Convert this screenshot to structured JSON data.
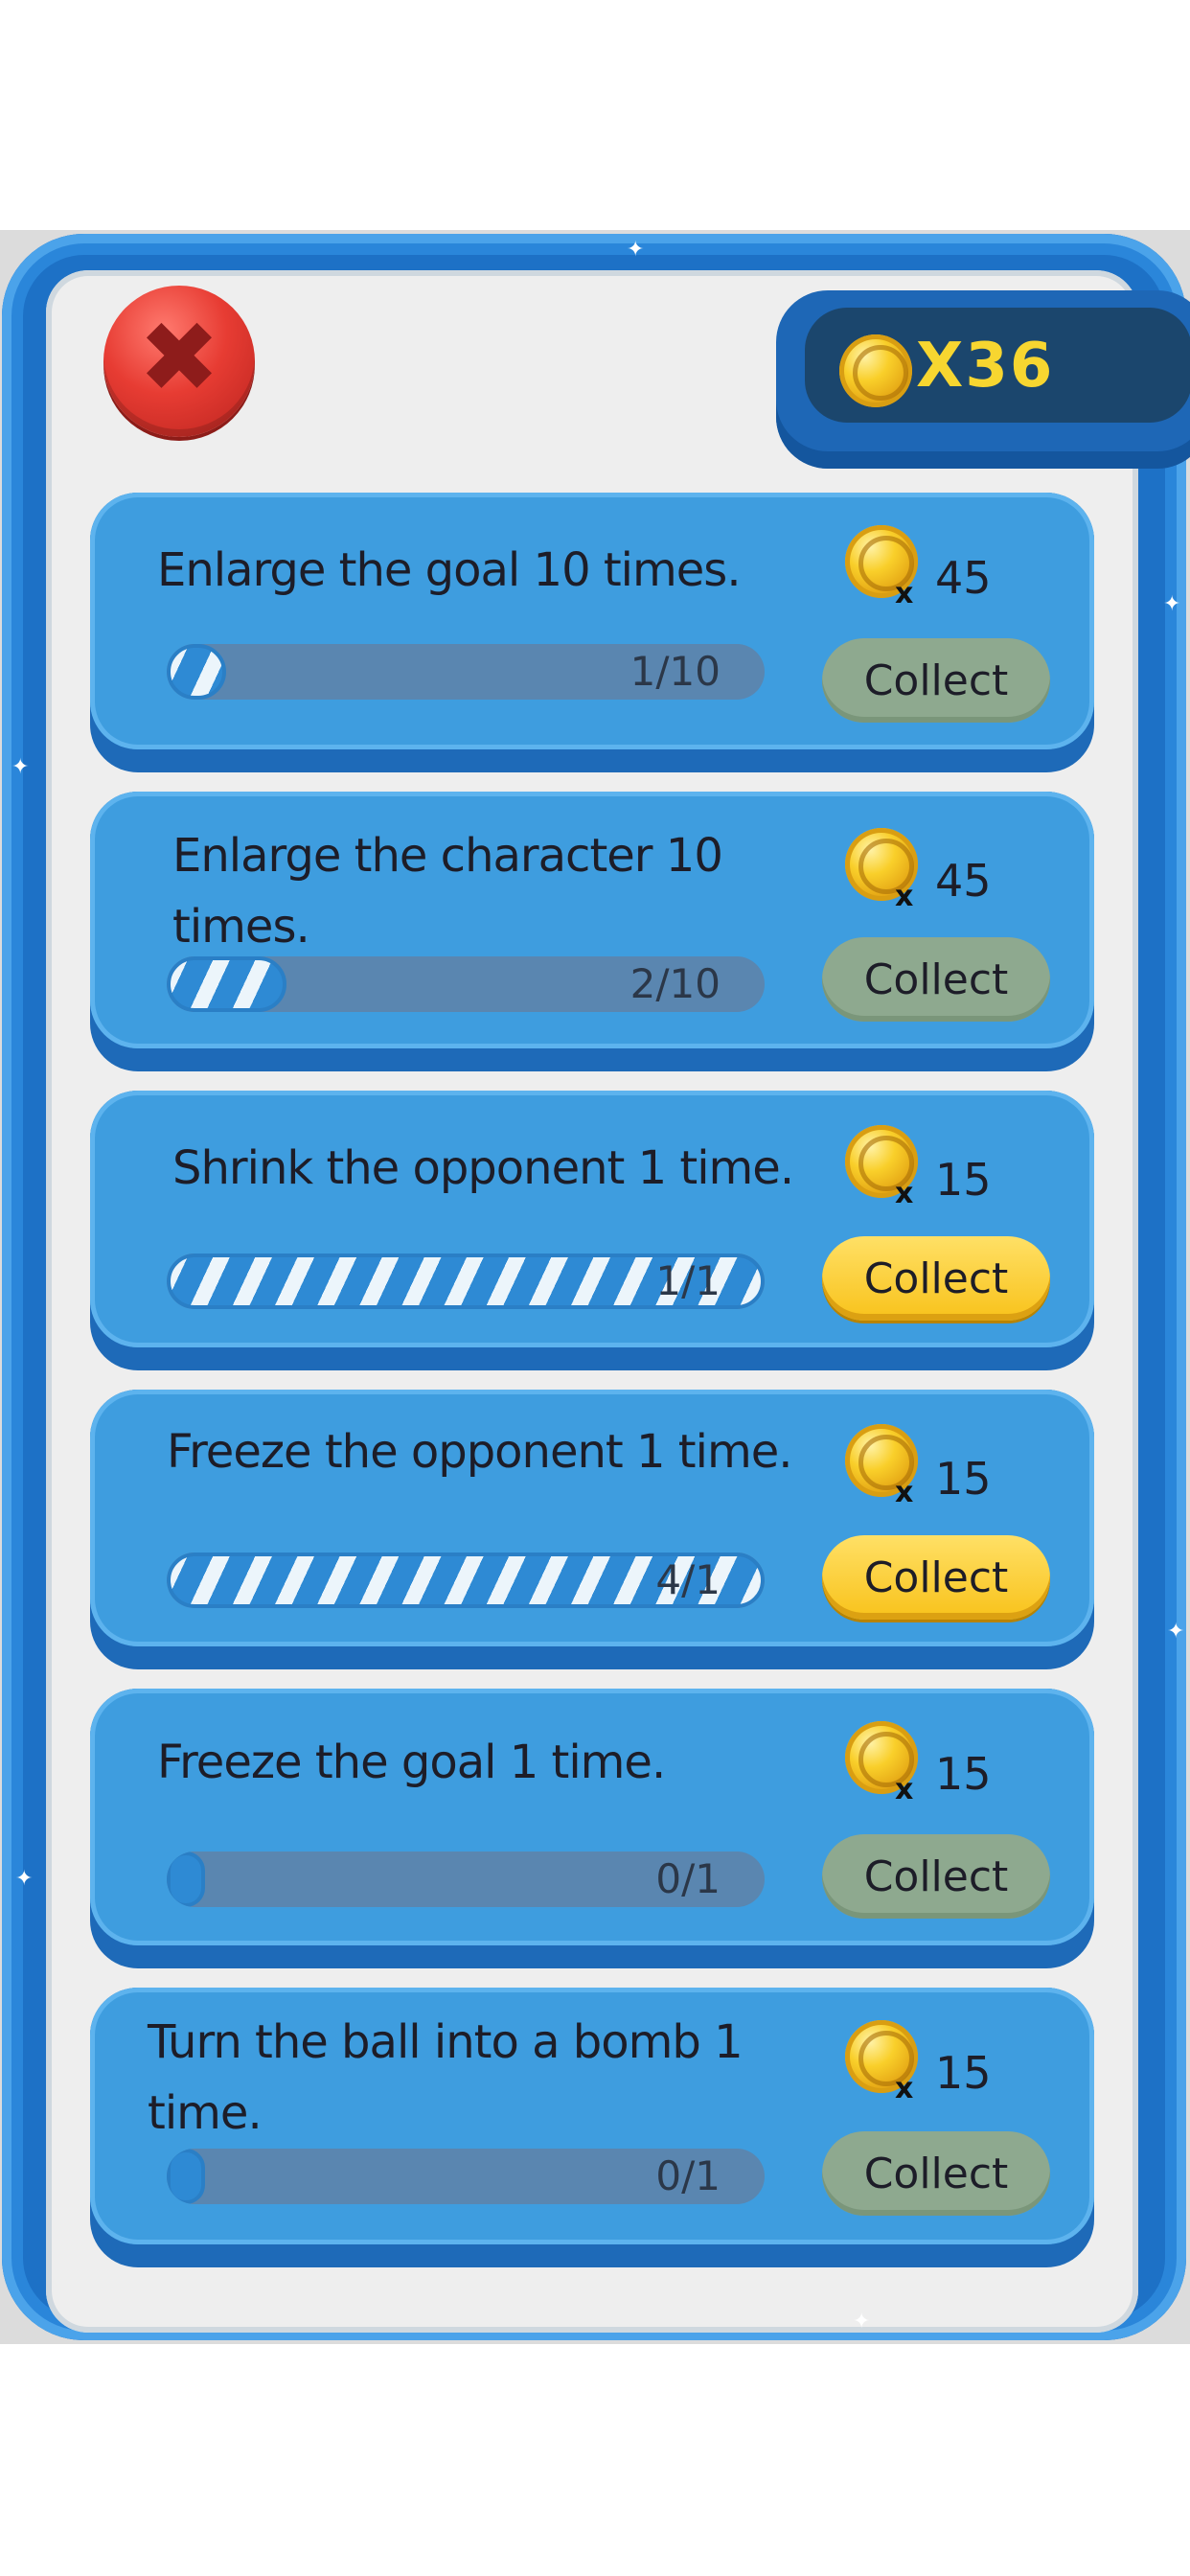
{
  "header": {
    "close_icon": "close-x-icon",
    "coin_icon": "gold-coin-icon",
    "coin_counter": "X36"
  },
  "quests": [
    {
      "title": "Enlarge the goal 10 times.",
      "reward_x": "x",
      "reward": "45",
      "progress_text": "1/10",
      "progress_fraction": 0.1,
      "button": "Collect",
      "collectable": false
    },
    {
      "title": "Enlarge the character 10 times.",
      "reward_x": "x",
      "reward": "45",
      "progress_text": "2/10",
      "progress_fraction": 0.2,
      "button": "Collect",
      "collectable": false
    },
    {
      "title": "Shrink the opponent 1 time.",
      "reward_x": "x",
      "reward": "15",
      "progress_text": "1/1",
      "progress_fraction": 1.0,
      "button": "Collect",
      "collectable": true
    },
    {
      "title": "Freeze the opponent 1 time.",
      "reward_x": "x",
      "reward": "15",
      "progress_text": "4/1",
      "progress_fraction": 1.0,
      "button": "Collect",
      "collectable": true
    },
    {
      "title": "Freeze the goal 1 time.",
      "reward_x": "x",
      "reward": "15",
      "progress_text": "0/1",
      "progress_fraction": 0.0,
      "button": "Collect",
      "collectable": false
    },
    {
      "title": "Turn the ball into a bomb 1 time.",
      "reward_x": "x",
      "reward": "15",
      "progress_text": "0/1",
      "progress_fraction": 0.0,
      "button": "Collect",
      "collectable": false
    }
  ],
  "colors": {
    "panel_blue": "#1d71c6",
    "card_blue": "#3e9ddf",
    "collect_enabled": "#f8c21a",
    "collect_disabled": "#8ea98f",
    "coin_text": "#f7d630"
  }
}
